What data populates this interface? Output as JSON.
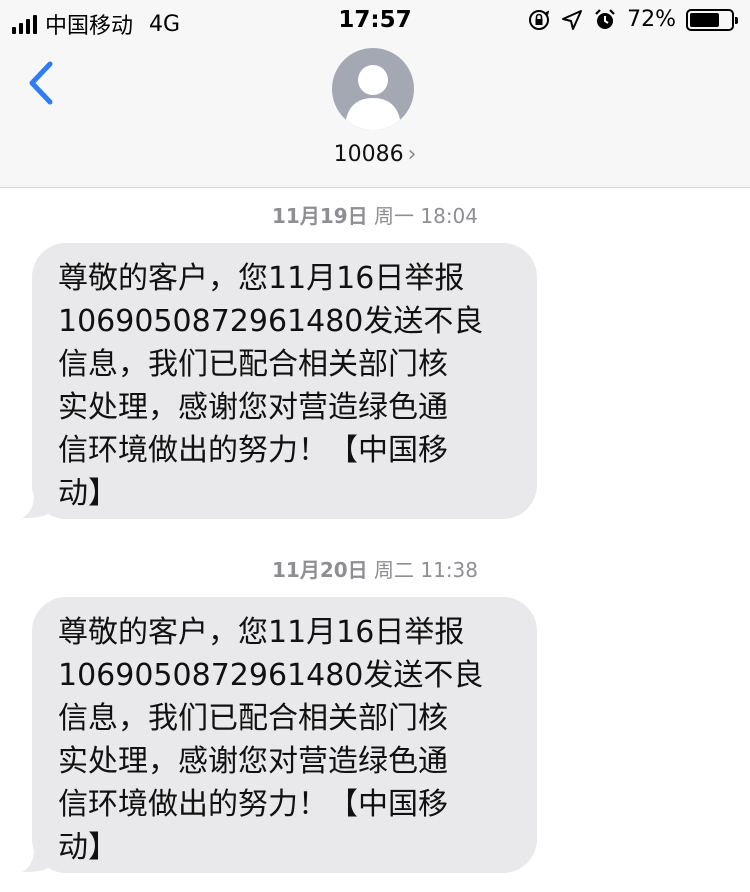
{
  "status_bar": {
    "carrier": "中国移动",
    "network": "4G",
    "time": "17:57",
    "battery_percent": "72%",
    "battery_level": 0.72
  },
  "header": {
    "contact_name": "10086",
    "chevron": "›"
  },
  "messages": [
    {
      "date": "11月19日",
      "meta": "周一 18:04",
      "text": "尊敬的客户，您11月16日举报\n1069050872961480发送不良\n信息，我们已配合相关部门核\n实处理，感谢您对营造绿色通\n信环境做出的努力！【中国移\n动】"
    },
    {
      "date": "11月20日",
      "meta": "周二 11:38",
      "text": "尊敬的客户，您11月16日举报\n1069050872961480发送不良\n信息，我们已配合相关部门核\n实处理，感谢您对营造绿色通\n信环境做出的努力！【中国移\n动】"
    }
  ],
  "icons": [
    "signal-icon",
    "lock-rotation-icon",
    "location-icon",
    "alarm-icon",
    "battery-icon",
    "back-chevron-icon",
    "contact-avatar-icon"
  ],
  "colors": {
    "accent": "#2f7cf6",
    "bubble": "#e9e9eb",
    "timestamp": "#8e8e93"
  }
}
